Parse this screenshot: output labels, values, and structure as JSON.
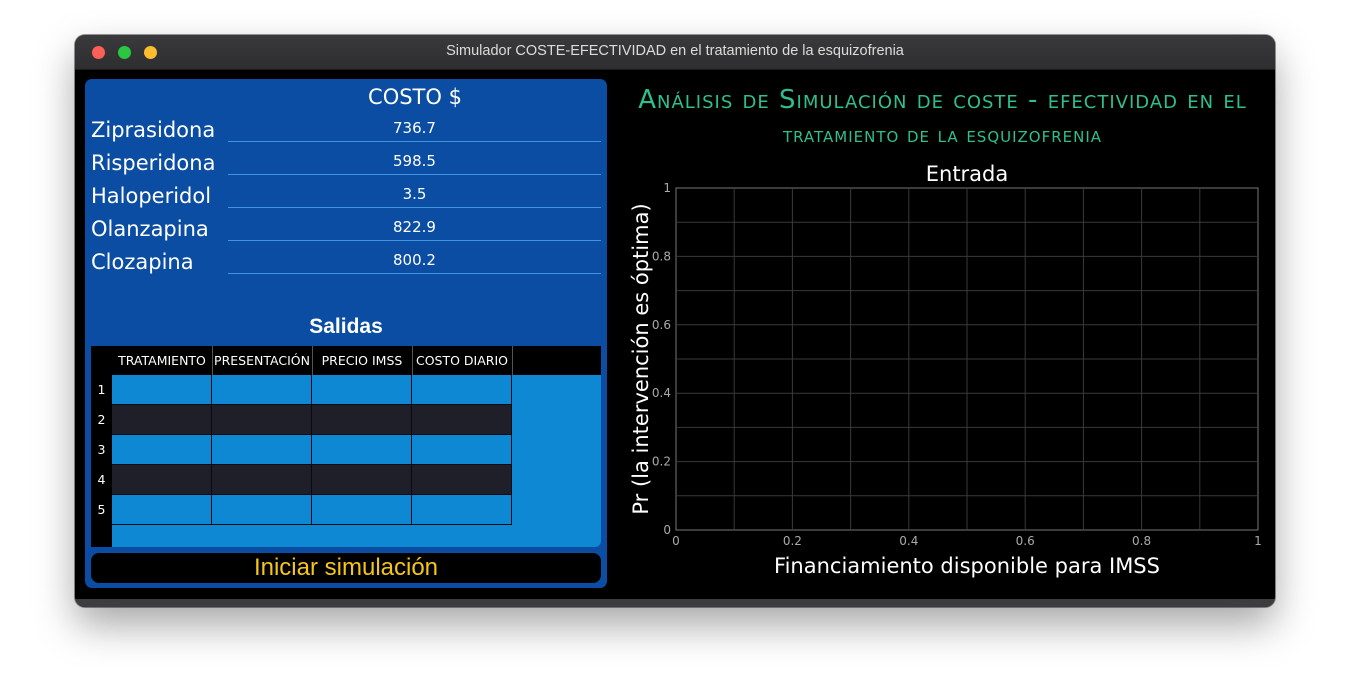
{
  "window": {
    "title": "Simulador COSTE-EFECTIVIDAD en el tratamiento de la esquizofrenia"
  },
  "inputs": {
    "header": "COSTO $",
    "drugs": [
      {
        "name": "Ziprasidona",
        "cost": "736.7"
      },
      {
        "name": "Risperidona",
        "cost": "598.5"
      },
      {
        "name": "Haloperidol",
        "cost": "3.5"
      },
      {
        "name": "Olanzapina",
        "cost": "822.9"
      },
      {
        "name": "Clozapina",
        "cost": "800.2"
      }
    ]
  },
  "outputs": {
    "title": "Salidas",
    "columns": [
      "TRATAMIENTO",
      "PRESENTACIÓN",
      "PRECIO IMSS",
      "COSTO DIARIO"
    ],
    "rows": [
      "1",
      "2",
      "3",
      "4",
      "5"
    ]
  },
  "start_button": "Iniciar simulación",
  "analysis": {
    "title_line1": "Análisis de Simulación de coste - efectividad en el",
    "title_line2": "tratamiento de la esquizofrenia"
  },
  "chart_data": {
    "type": "line",
    "title": "Entrada",
    "xlabel": "Financiamiento disponible para IMSS",
    "ylabel": "Pr (la intervención es óptima)",
    "xlim": [
      0,
      1
    ],
    "ylim": [
      0,
      1
    ],
    "xticks": [
      "0",
      "0.2",
      "0.4",
      "0.6",
      "0.8",
      "1"
    ],
    "yticks": [
      "0",
      "0.2",
      "0.4",
      "0.6",
      "0.8",
      "1"
    ],
    "grid": true,
    "series": []
  },
  "colors": {
    "panel": "#0b4da2",
    "table_light": "#0e88d3",
    "table_dark": "#1e1f29",
    "button_text": "#f5c518",
    "title_accent": "#2fbf8f"
  }
}
